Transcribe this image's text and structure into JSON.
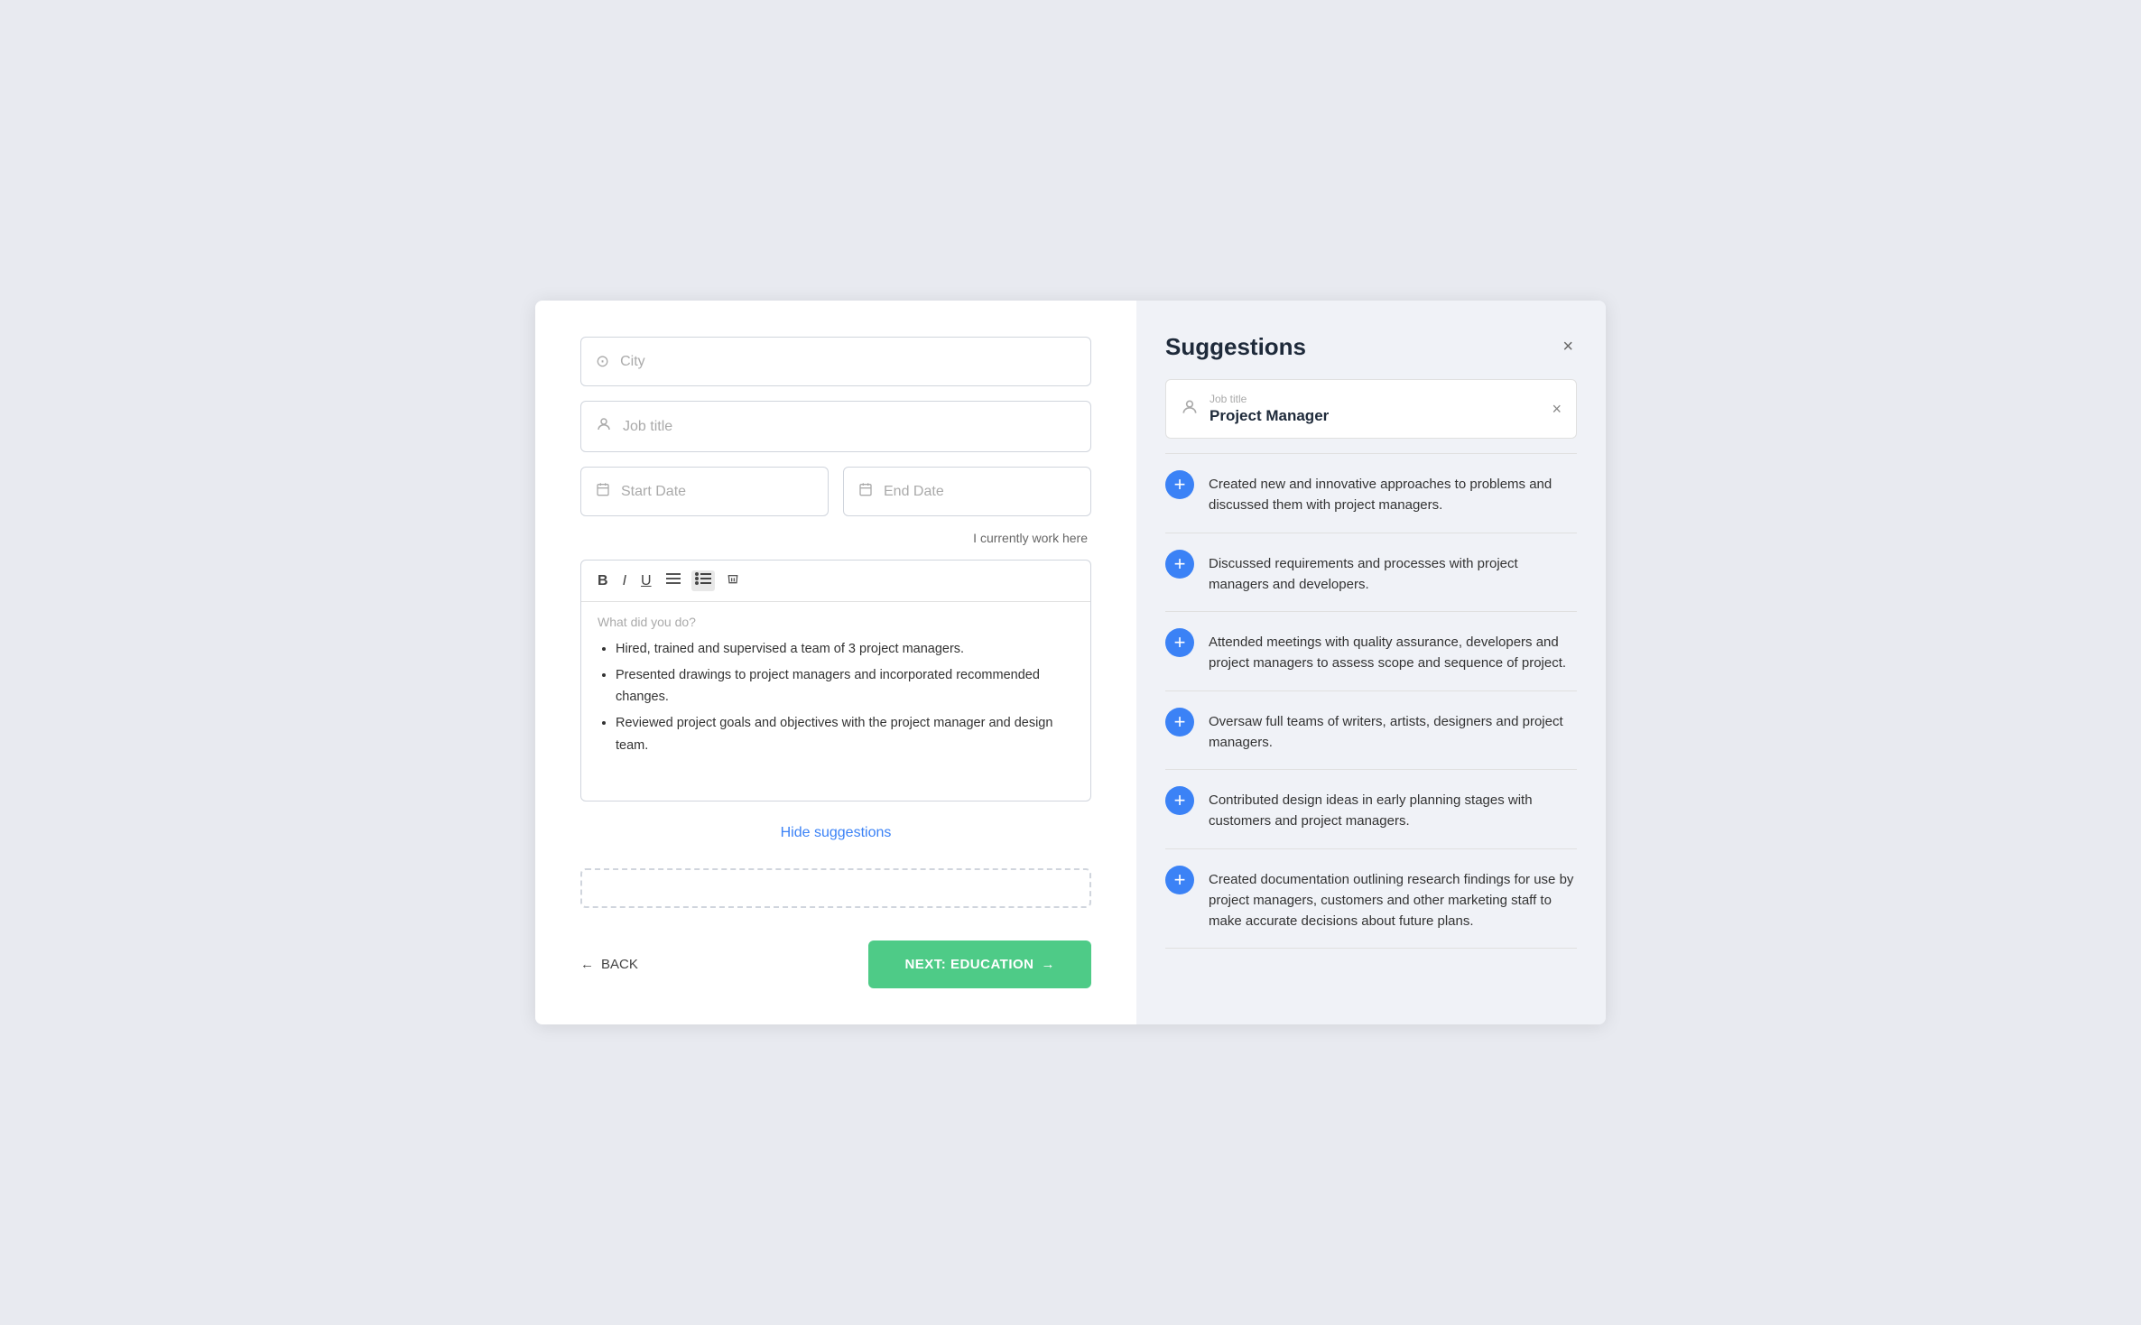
{
  "left": {
    "city_placeholder": "City",
    "job_title_placeholder": "Job title",
    "start_date_placeholder": "Start Date",
    "end_date_placeholder": "End Date",
    "currently_work_label": "I currently work here",
    "editor_placeholder": "What did you do?",
    "editor_bullets": [
      "Hired, trained and supervised a team of 3 project managers.",
      "Presented drawings to project managers and incorporated recommended changes.",
      "Reviewed project goals and objectives with the project manager and design team."
    ],
    "hide_suggestions_label": "Hide suggestions",
    "back_label": "BACK",
    "next_label": "NEXT: EDUCATION"
  },
  "right": {
    "panel_title": "Suggestions",
    "job_card": {
      "label": "Job title",
      "value": "Project Manager"
    },
    "suggestions": [
      "Created new and innovative approaches to problems and discussed them with project managers.",
      "Discussed requirements and processes with project managers and developers.",
      "Attended meetings with quality assurance, developers and project managers to assess scope and sequence of project.",
      "Oversaw full teams of writers, artists, designers and project managers.",
      "Contributed design ideas in early planning stages with customers and project managers.",
      "Created documentation outlining research findings for use by project managers, customers and other marketing staff to make accurate decisions about future plans."
    ]
  },
  "icons": {
    "location": "📍",
    "person": "👤",
    "calendar": "📅",
    "bold": "B",
    "italic": "I",
    "underline": "U",
    "align": "≡",
    "list": "☰",
    "clear": "⊘",
    "arrow_left": "←",
    "arrow_right": "→",
    "close": "×",
    "plus": "+"
  }
}
